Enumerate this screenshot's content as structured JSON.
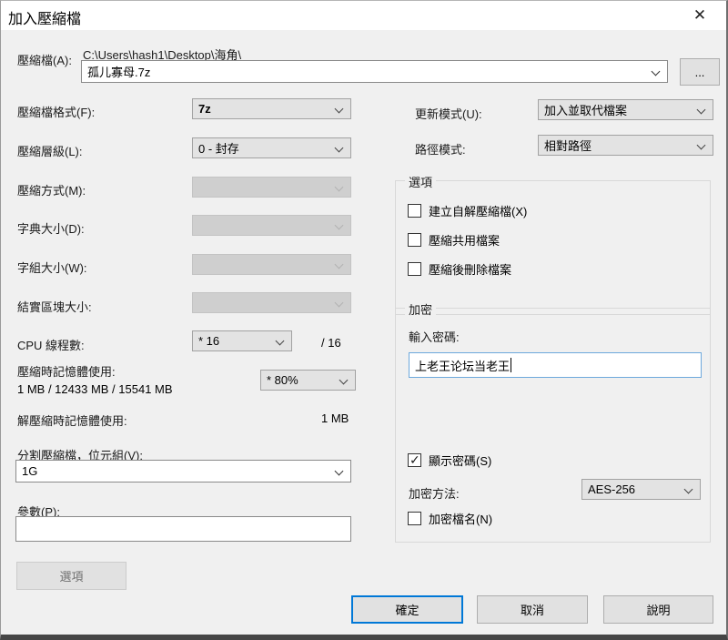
{
  "window": {
    "title": "加入壓縮檔",
    "close_glyph": "✕"
  },
  "archive": {
    "label": "壓縮檔(A):",
    "path": "C:\\Users\\hash1\\Desktop\\海角\\",
    "name": "孤儿寡母.7z",
    "browse_label": "..."
  },
  "left": {
    "format": {
      "label": "壓縮檔格式(F):",
      "value": "7z"
    },
    "level": {
      "label": "壓縮層級(L):",
      "value": "0 - 封存"
    },
    "method": {
      "label": "壓縮方式(M):",
      "value": ""
    },
    "dict": {
      "label": "字典大小(D):",
      "value": ""
    },
    "word": {
      "label": "字組大小(W):",
      "value": ""
    },
    "solid": {
      "label": "結實區塊大小:",
      "value": ""
    },
    "cpu": {
      "label": "CPU 線程數:",
      "value": "* 16",
      "suffix": "/ 16"
    },
    "mem_compress": {
      "label": "壓縮時記憶體使用:",
      "detail": "1 MB / 12433 MB / 15541 MB",
      "value": "* 80%"
    },
    "mem_decompress": {
      "label": "解壓縮時記憶體使用:",
      "value": "1 MB"
    },
    "split": {
      "label": "分割壓縮檔，位元組(V):",
      "value": "1G"
    },
    "params": {
      "label": "參數(P):",
      "value": ""
    },
    "options_button": "選項"
  },
  "right": {
    "update_mode": {
      "label": "更新模式(U):",
      "value": "加入並取代檔案"
    },
    "path_mode": {
      "label": "路徑模式:",
      "value": "相對路徑"
    },
    "options_group": {
      "title": "選項",
      "checkboxes": [
        {
          "label": "建立自解壓縮檔(X)",
          "checked": false
        },
        {
          "label": "壓縮共用檔案",
          "checked": false
        },
        {
          "label": "壓縮後刪除檔案",
          "checked": false
        }
      ]
    },
    "encryption_group": {
      "title": "加密",
      "password_label": "輸入密碼:",
      "password_value": "上老王论坛当老王",
      "show_password": {
        "label": "顯示密碼(S)",
        "checked": true
      },
      "method": {
        "label": "加密方法:",
        "value": "AES-256"
      },
      "encrypt_names": {
        "label": "加密檔名(N)",
        "checked": false
      }
    }
  },
  "footer": {
    "ok": "確定",
    "cancel": "取消",
    "help": "說明"
  }
}
